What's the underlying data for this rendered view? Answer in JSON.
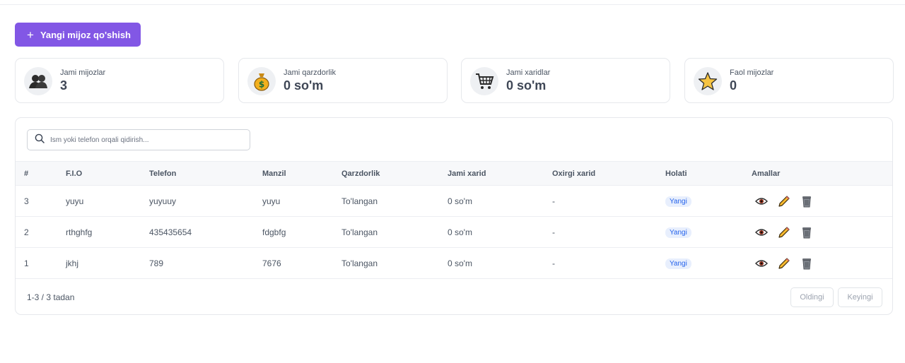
{
  "header": {
    "add_button_label": "Yangi mijoz qo'shish"
  },
  "stats": [
    {
      "icon": "people-icon",
      "label": "Jami mijozlar",
      "value": "3"
    },
    {
      "icon": "money-bag-icon",
      "label": "Jami qarzdorlik",
      "value": "0 so'm"
    },
    {
      "icon": "cart-icon",
      "label": "Jami xaridlar",
      "value": "0 so'm"
    },
    {
      "icon": "star-icon",
      "label": "Faol mijozlar",
      "value": "0"
    }
  ],
  "search": {
    "placeholder": "Ism yoki telefon orqali qidirish..."
  },
  "table": {
    "columns": [
      "#",
      "F.I.O",
      "Telefon",
      "Manzil",
      "Qarzdorlik",
      "Jami xarid",
      "Oxirgi xarid",
      "Holati",
      "Amallar"
    ],
    "rows": [
      {
        "id": "3",
        "name": "yuyu",
        "phone": "yuyuuy",
        "address": "yuyu",
        "debt": "To'langan",
        "total": "0 so'm",
        "last": "-",
        "status": "Yangi"
      },
      {
        "id": "2",
        "name": "rthghfg",
        "phone": "435435654",
        "address": "fdgbfg",
        "debt": "To'langan",
        "total": "0 so'm",
        "last": "-",
        "status": "Yangi"
      },
      {
        "id": "1",
        "name": "jkhj",
        "phone": "789",
        "address": "7676",
        "debt": "To'langan",
        "total": "0 so'm",
        "last": "-",
        "status": "Yangi"
      }
    ]
  },
  "pagination": {
    "info": "1-3 / 3 tadan",
    "prev_label": "Oldingi",
    "next_label": "Keyingi"
  },
  "colors": {
    "accent": "#8257e5",
    "badge_bg": "#e8effd",
    "badge_text": "#2563eb"
  }
}
